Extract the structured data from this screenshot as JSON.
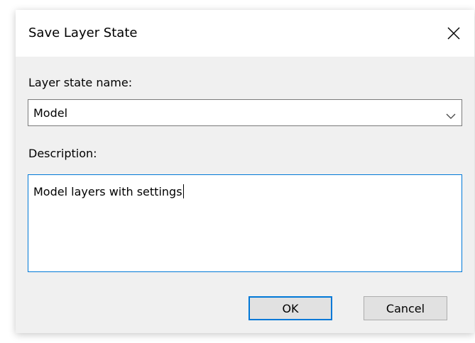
{
  "dialog": {
    "title": "Save Layer State",
    "close_icon": "close-icon"
  },
  "layer_state": {
    "label": "Layer state name:",
    "selected_value": "Model",
    "dropdown_icon": "chevron-down-icon"
  },
  "description": {
    "label": "Description:",
    "value": "Model layers with settings"
  },
  "buttons": {
    "ok_label": "OK",
    "cancel_label": "Cancel"
  },
  "colors": {
    "focus_accent": "#0078d7",
    "dialog_background": "#f0f0f0",
    "button_background": "#e1e1e1"
  }
}
